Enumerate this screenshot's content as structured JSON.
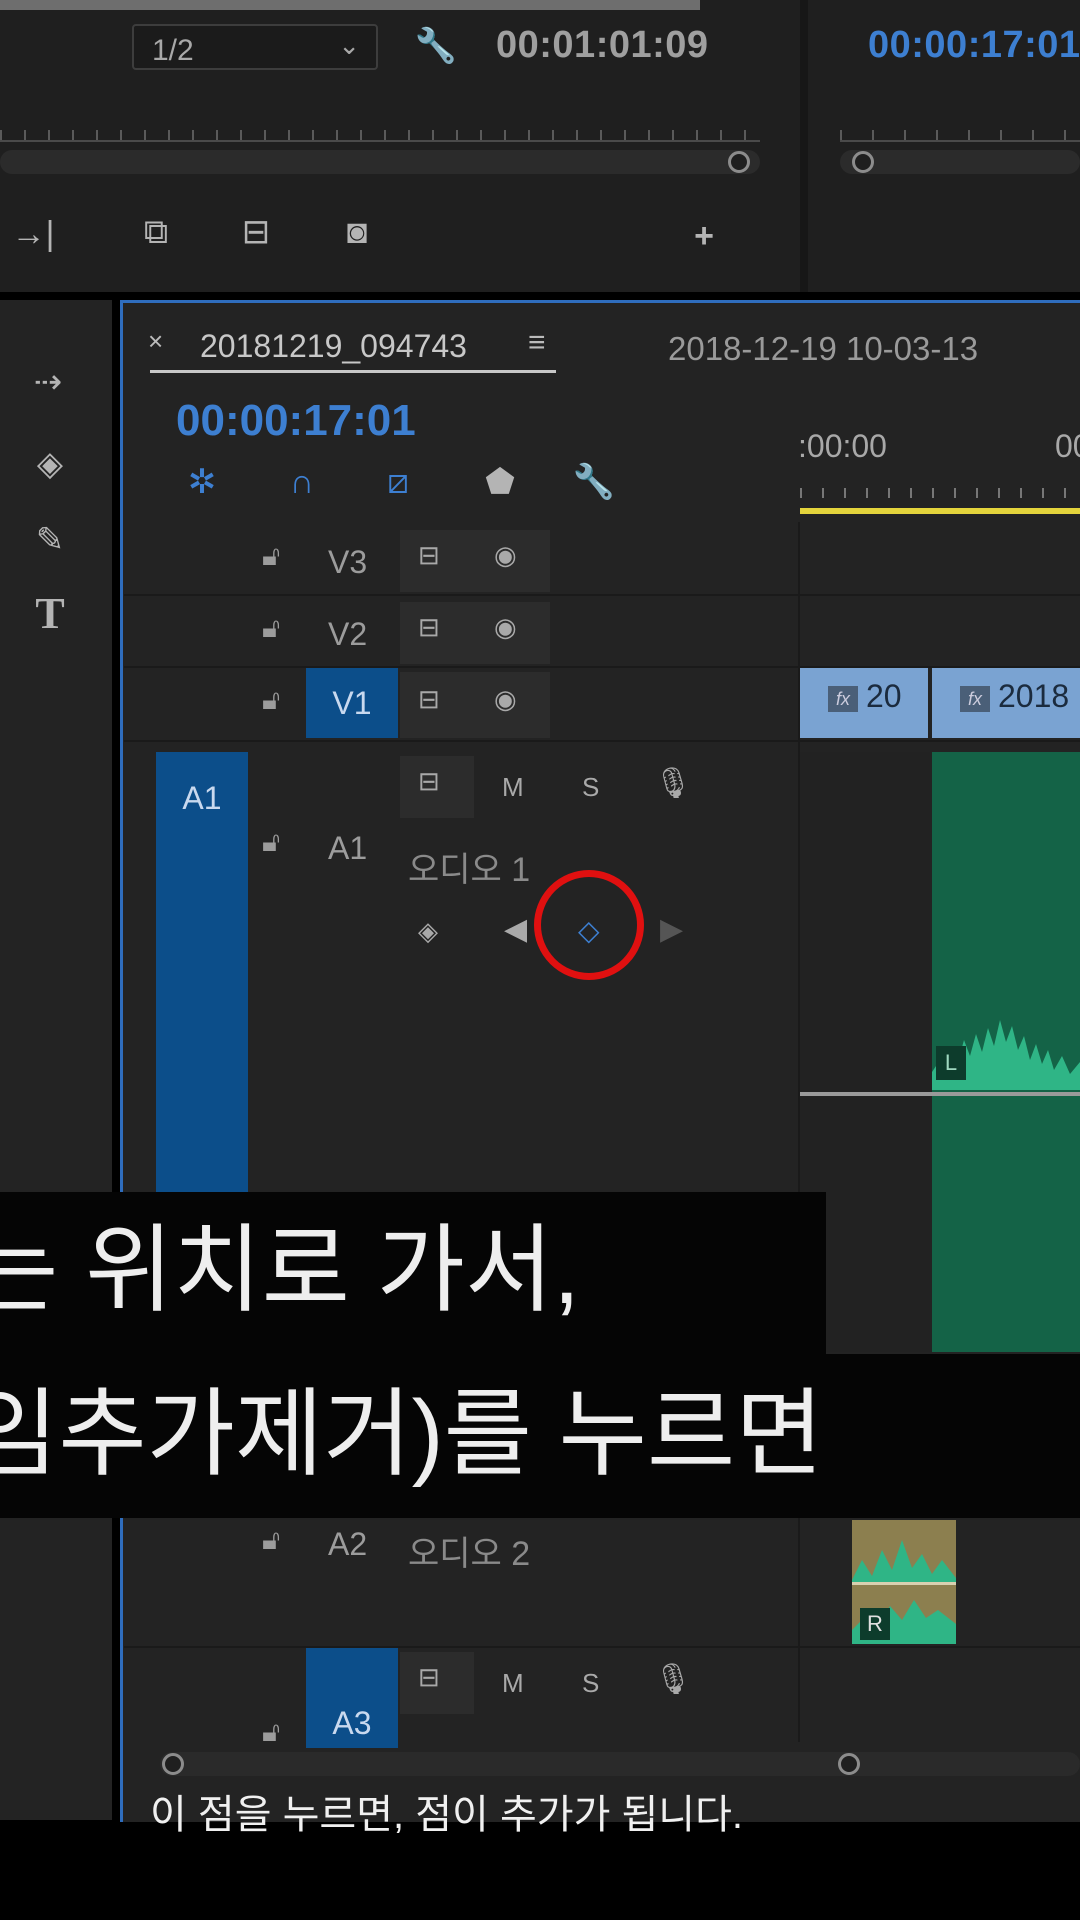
{
  "source_monitor": {
    "zoom_value": "1/2",
    "timecode": "00:01:01:09"
  },
  "program_monitor": {
    "timecode": "00:00:17:01"
  },
  "timeline": {
    "sequence_tab": "20181219_094743",
    "other_sequence": "2018-12-19 10-03-13",
    "playhead_timecode": "00:00:17:01",
    "ruler_label": ":00:00",
    "ruler_label_2": "00",
    "tracks": {
      "v3": "V3",
      "v2": "V2",
      "v1": "V1",
      "a1_target": "A1",
      "a1": "A1",
      "a1_name": "오디오 1",
      "a2": "A2",
      "a2_name": "오디오 2",
      "a3": "A3",
      "mute": "M",
      "solo": "S"
    },
    "clips": {
      "v1_clip_a": "20",
      "v1_clip_b": "2018",
      "audio_left": "L",
      "audio_right": "R"
    }
  },
  "subtitles": {
    "line1": "는 위치로 가서,",
    "line2": "임추가제거)를 누르면",
    "caption": "이 점을 누르면, 점이 추가가 됩니다."
  },
  "colors": {
    "accent_blue": "#3d7fd1",
    "target_blue": "#0c4e8a",
    "annotation_red": "#e01010",
    "audio_clip": "#146347"
  }
}
